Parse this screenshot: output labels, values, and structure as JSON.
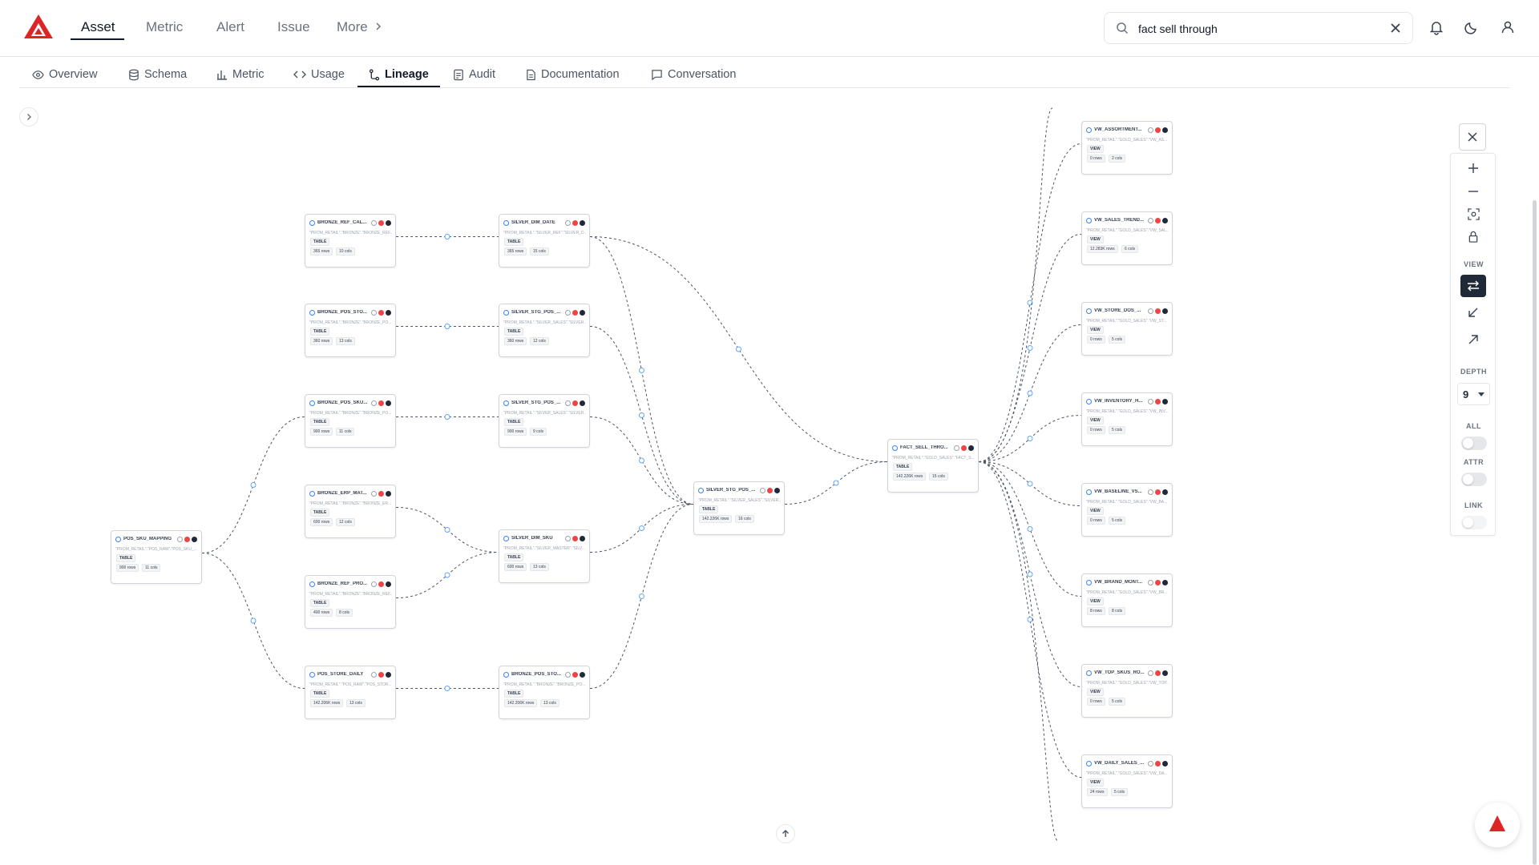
{
  "app": {
    "brand_color": "#dc2626"
  },
  "nav": {
    "tabs": [
      "Asset",
      "Metric",
      "Alert",
      "Issue",
      "More"
    ],
    "active": "Asset"
  },
  "search": {
    "value": "fact sell through"
  },
  "subtabs": {
    "items": [
      "Overview",
      "Schema",
      "Metric",
      "Usage",
      "Lineage",
      "Audit",
      "Documentation",
      "Conversation"
    ],
    "active": "Lineage"
  },
  "nodes": [
    {
      "name": "POS_SKU_MAPPING",
      "path": "\"PROM_RETAIL\".\"POS_RAW\".\"POS_SKU_...",
      "type": "TABLE",
      "rows": "900 rows",
      "cols": "11 cols"
    },
    {
      "name": "BRONZE_REF_CAL...",
      "path": "\"PROM_RETAIL\".\"BRONZE\".\"BRONZE_REF...",
      "type": "TABLE",
      "rows": "365 rows",
      "cols": "10 cols"
    },
    {
      "name": "BRONZE_POS_STO...",
      "path": "\"PROM_RETAIL\".\"BRONZE\".\"BRONZE_PO...",
      "type": "TABLE",
      "rows": "360 rows",
      "cols": "13 cols"
    },
    {
      "name": "BRONZE_POS_SKU...",
      "path": "\"PROM_RETAIL\".\"BRONZE\".\"BRONZE_PO...",
      "type": "TABLE",
      "rows": "900 rows",
      "cols": "11 cols"
    },
    {
      "name": "BRONZE_ERP_MAT...",
      "path": "\"PROM_RETAIL\".\"BRONZE\".\"BRONZE_ER...",
      "type": "TABLE",
      "rows": "600 rows",
      "cols": "12 cols"
    },
    {
      "name": "BRONZE_REF_PRO...",
      "path": "\"PROM_RETAIL\".\"BRONZE\".\"BRONZE_REF...",
      "type": "TABLE",
      "rows": "400 rows",
      "cols": "8 cols"
    },
    {
      "name": "POS_STORE_DAILY",
      "path": "\"PROM_RETAIL\".\"POS_RAW\".\"POS_STOR...",
      "type": "TABLE",
      "rows": "142.206K rows",
      "cols": "13 cols"
    },
    {
      "name": "SILVER_DIM_DATE",
      "path": "\"PROM_RETAIL\".\"SILVER_REF\".\"SILVER_D...",
      "type": "TABLE",
      "rows": "365 rows",
      "cols": "15 cols"
    },
    {
      "name": "SILVER_STG_POS_...",
      "path": "\"PROM_RETAIL\".\"SILVER_SALES\".\"SILVER...",
      "type": "TABLE",
      "rows": "360 rows",
      "cols": "12 cols"
    },
    {
      "name": "SILVER_STG_POS_...",
      "path": "\"PROM_RETAIL\".\"SILVER_SALES\".\"SILVER...",
      "type": "TABLE",
      "rows": "900 rows",
      "cols": "9 cols"
    },
    {
      "name": "SILVER_DIM_SKU",
      "path": "\"PROM_RETAIL\".\"SILVER_MASTER\".\"SILV...",
      "type": "TABLE",
      "rows": "600 rows",
      "cols": "13 cols"
    },
    {
      "name": "BRONZE_POS_STO...",
      "path": "\"PROM_RETAIL\".\"BRONZE\".\"BRONZE_PO...",
      "type": "TABLE",
      "rows": "142.206K rows",
      "cols": "13 cols"
    },
    {
      "name": "SILVER_STG_POS_...",
      "path": "\"PROM_RETAIL\".\"SILVER_SALES\".\"SILVER...",
      "type": "TABLE",
      "rows": "142.226K rows",
      "cols": "16 cols"
    },
    {
      "name": "FACT_SELL_THRO...",
      "path": "\"PROM_RETAIL\".\"GOLD_SALES\".\"FACT_S...",
      "type": "TABLE",
      "rows": "142.226K rows",
      "cols": "15 cols"
    },
    {
      "name": "VW_ASSORTMENT...",
      "path": "\"PROM_RETAIL\".\"GOLD_SALES\".\"VW_AS...",
      "type": "VIEW",
      "rows": "0 rows",
      "cols": "2 cols"
    },
    {
      "name": "VW_SALES_TREND...",
      "path": "\"PROM_RETAIL\".\"GOLD_SALES\".\"VW_SAL...",
      "type": "VIEW",
      "rows": "12.283K rows",
      "cols": "6 cols"
    },
    {
      "name": "VW_STORE_DOS_...",
      "path": "\"PROM_RETAIL\".\"GOLD_SALES\".\"VW_ST...",
      "type": "VIEW",
      "rows": "0 rows",
      "cols": "5 cols"
    },
    {
      "name": "VW_INVENTORY_H...",
      "path": "\"PROM_RETAIL\".\"GOLD_SALES\".\"VW_INV...",
      "type": "VIEW",
      "rows": "0 rows",
      "cols": "5 cols"
    },
    {
      "name": "VW_BASELINE_VS...",
      "path": "\"PROM_RETAIL\".\"GOLD_SALES\".\"VW_BA...",
      "type": "VIEW",
      "rows": "0 rows",
      "cols": "5 cols"
    },
    {
      "name": "VW_BRAND_MONT...",
      "path": "\"PROM_RETAIL\".\"GOLD_SALES\".\"VW_BR...",
      "type": "VIEW",
      "rows": "8 rows",
      "cols": "8 cols"
    },
    {
      "name": "VW_TOP_SKUS_RO...",
      "path": "\"PROM_RETAIL\".\"GOLD_SALES\".\"VW_TOP...",
      "type": "VIEW",
      "rows": "0 rows",
      "cols": "5 cols"
    },
    {
      "name": "VW_DAILY_SALES_...",
      "path": "\"PROM_RETAIL\".\"GOLD_SALES\".\"VW_DA...",
      "type": "VIEW",
      "rows": "24 rows",
      "cols": "5 cols"
    }
  ],
  "panel": {
    "view_label": "VIEW",
    "depth_label": "DEPTH",
    "depth_value": "9",
    "all_label": "ALL",
    "attr_label": "ATTR",
    "link_label": "LINK"
  }
}
